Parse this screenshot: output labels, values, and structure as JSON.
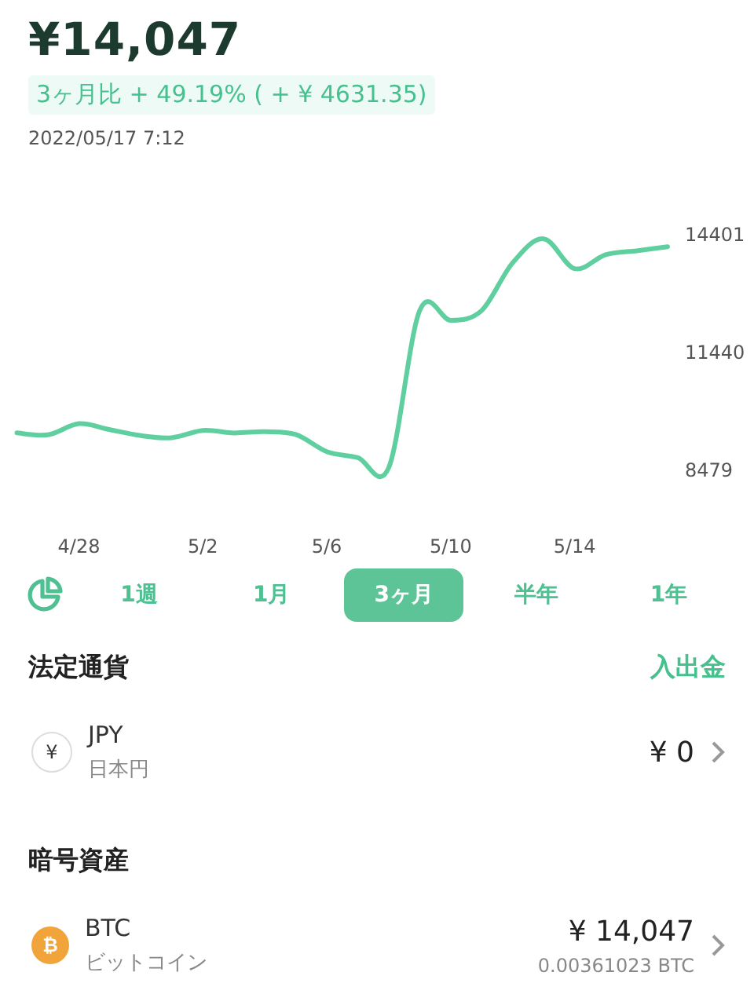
{
  "balance": {
    "total": "¥14,047",
    "change": "3ヶ月比 + 49.19% ( + ¥ 4631.35)",
    "timestamp": "2022/05/17 7:12"
  },
  "chart": {
    "chart_data": {
      "type": "line",
      "ylim": [
        8479,
        14401
      ],
      "yticks": [
        8479,
        11440,
        14401
      ],
      "categories": [
        null,
        null,
        "4/28",
        null,
        null,
        null,
        "5/2",
        null,
        null,
        null,
        "5/6",
        null,
        null,
        null,
        "5/10",
        null,
        null,
        null,
        "5/14",
        null,
        null,
        null
      ],
      "series": [
        {
          "color": "#5fcf9f",
          "values": [
            9420,
            9370,
            9650,
            9500,
            9350,
            9300,
            9480,
            9420,
            9450,
            9380,
            8950,
            8800,
            8550,
            12500,
            12250,
            12500,
            13700,
            14300,
            13550,
            13900,
            14000,
            14100
          ]
        }
      ]
    }
  },
  "ranges": [
    {
      "label": "1週",
      "selected": false
    },
    {
      "label": "1月",
      "selected": false
    },
    {
      "label": "3ヶ月",
      "selected": true
    },
    {
      "label": "半年",
      "selected": false
    },
    {
      "label": "1年",
      "selected": false
    }
  ],
  "sections": [
    {
      "title": "法定通貨",
      "action": "入出金",
      "rows": [
        {
          "kind": "fiat",
          "symbol": "¥",
          "code": "JPY",
          "name": "日本円",
          "amount": "¥ 0"
        }
      ]
    },
    {
      "title": "暗号資産",
      "rows": [
        {
          "kind": "crypto",
          "symbol": "₿",
          "code": "BTC",
          "name": "ビットコイン",
          "amount": "¥ 14,047",
          "quantity": "0.00361023 BTC"
        }
      ]
    }
  ]
}
